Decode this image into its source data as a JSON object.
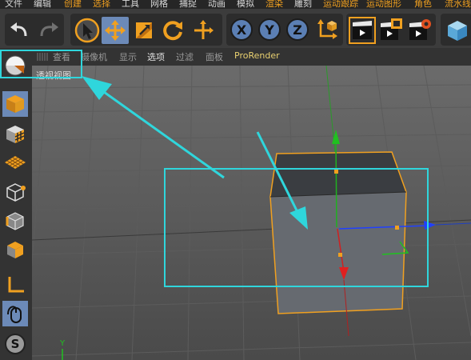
{
  "menu": [
    "文件",
    "编辑",
    "创建",
    "选择",
    "工具",
    "网格",
    "捕捉",
    "动画",
    "模拟",
    "渲染",
    "雕刻",
    "运动跟踪",
    "运动图形",
    "角色",
    "流水线"
  ],
  "toolbar": {
    "axis_x": "X",
    "axis_y": "Y",
    "axis_z": "Z"
  },
  "viewport_menu": [
    "查看",
    "摄像机",
    "显示",
    "选项",
    "过滤",
    "面板",
    "ProRender"
  ],
  "viewport": {
    "view_name": "透视视图",
    "world_axis_label": "Y"
  },
  "left_tools": {
    "snap_label": "S"
  },
  "colors": {
    "highlight": "#2fd6dc",
    "accent_orange": "#f0a020",
    "axis_x": "#e02020",
    "axis_y": "#20c020",
    "axis_z": "#2040ff"
  }
}
